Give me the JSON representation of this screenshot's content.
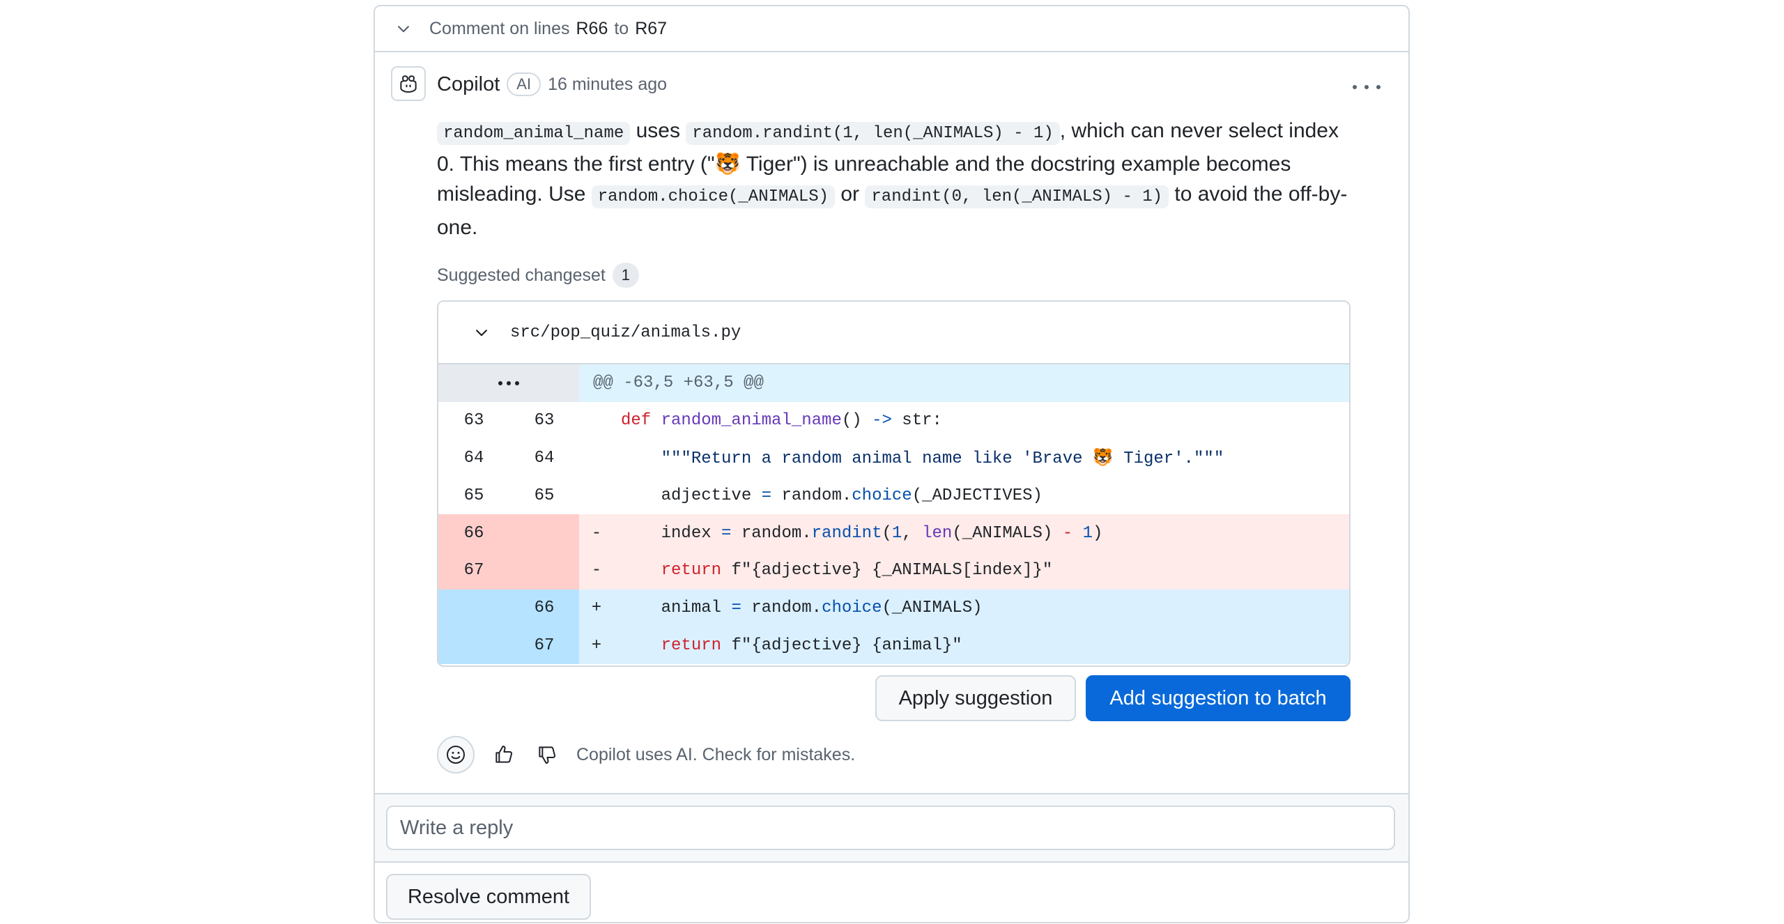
{
  "thread": {
    "header_prefix": "Comment on lines",
    "line_start": "R66",
    "to": "to",
    "line_end": "R67"
  },
  "comment": {
    "author": "Copilot",
    "badge": "AI",
    "time": "16 minutes ago",
    "body": {
      "code1": "random_animal_name",
      "t1": " uses ",
      "code2": "random.randint(1, len(_ANIMALS) - 1)",
      "t2": ", which can never select index 0. This means the first entry (\"🐯 Tiger\") is unreachable and the docstring example becomes misleading. Use ",
      "code3": "random.choice(_ANIMALS)",
      "t3": " or ",
      "code4": "randint(0, len(_ANIMALS) - 1)",
      "t4": " to avoid the off-by-one."
    }
  },
  "suggestion": {
    "label": "Suggested changeset",
    "count": "1",
    "file": "src/pop_quiz/animals.py",
    "hunk": "@@ -63,5 +63,5 @@",
    "lines": [
      {
        "old": "63",
        "new": "63",
        "sign": "",
        "tokens": [
          [
            "kw",
            "def "
          ],
          [
            "fn",
            "random_animal_name"
          ],
          [
            "",
            "() "
          ],
          [
            "op",
            "->"
          ],
          [
            "",
            " str:"
          ]
        ]
      },
      {
        "old": "64",
        "new": "64",
        "sign": "",
        "tokens": [
          [
            "str",
            "    \"\"\"Return a random animal name like 'Brave 🐯 Tiger'.\"\"\""
          ]
        ]
      },
      {
        "old": "65",
        "new": "65",
        "sign": "",
        "tokens": [
          [
            "",
            "    adjective "
          ],
          [
            "op",
            "="
          ],
          [
            "",
            " random."
          ],
          [
            "op",
            "choice"
          ],
          [
            "",
            "(_ADJECTIVES)"
          ]
        ]
      },
      {
        "old": "66",
        "new": "",
        "sign": "-",
        "tokens": [
          [
            "",
            "    index "
          ],
          [
            "op",
            "="
          ],
          [
            "",
            " random."
          ],
          [
            "op",
            "randint"
          ],
          [
            "",
            "("
          ],
          [
            "op",
            "1"
          ],
          [
            ", "
          ],
          [
            "fn",
            "len"
          ],
          [
            "",
            "(_ANIMALS) "
          ],
          [
            "kw",
            "-"
          ],
          [
            " "
          ],
          [
            "op",
            "1"
          ],
          [
            ")"
          ]
        ]
      },
      {
        "old": "67",
        "new": "",
        "sign": "-",
        "tokens": [
          [
            "kw",
            "    return "
          ],
          [
            "",
            "f\"{adjective} {_ANIMALS[index]}\""
          ]
        ]
      },
      {
        "old": "",
        "new": "66",
        "sign": "+",
        "tokens": [
          [
            "",
            "    animal "
          ],
          [
            "op",
            "="
          ],
          [
            "",
            " random."
          ],
          [
            "op",
            "choice"
          ],
          [
            "",
            "(_ANIMALS)"
          ]
        ]
      },
      {
        "old": "",
        "new": "67",
        "sign": "+",
        "tokens": [
          [
            "kw",
            "    return "
          ],
          [
            "",
            "f\"{adjective} {animal}\""
          ]
        ]
      }
    ],
    "apply_label": "Apply suggestion",
    "batch_label": "Add suggestion to batch"
  },
  "footer": {
    "disclaimer": "Copilot uses AI. Check for mistakes."
  },
  "reply": {
    "placeholder": "Write a reply"
  },
  "resolve_label": "Resolve comment",
  "colors": {
    "accent": "#0969da",
    "border": "#d1d9e0",
    "deletion_bg": "#ffebe9",
    "addition_bg": "#daf0ff"
  }
}
